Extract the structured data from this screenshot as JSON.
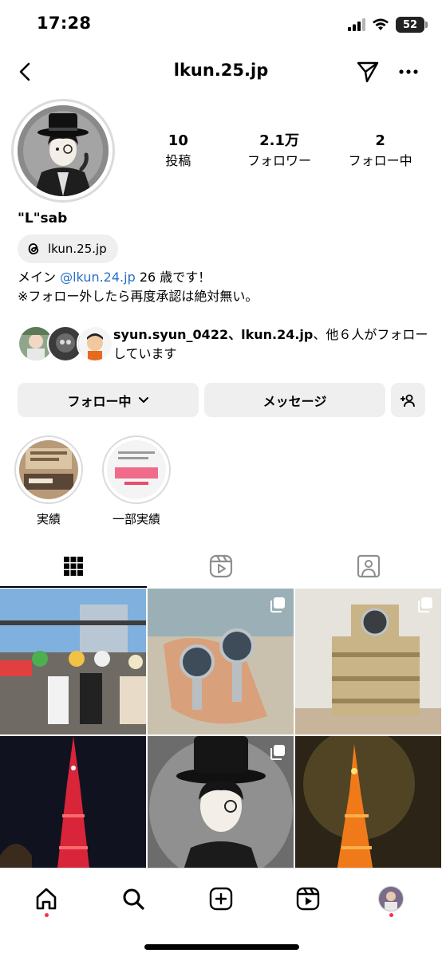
{
  "status_bar": {
    "time": "17:28",
    "battery": "52"
  },
  "header": {
    "username": "lkun.25.jp"
  },
  "profile": {
    "stats": [
      {
        "value": "10",
        "label": "投稿"
      },
      {
        "value": "2.1万",
        "label": "フォロワー"
      },
      {
        "value": "2",
        "label": "フォロー中"
      }
    ],
    "display_name": "\"L\"sab",
    "threads_handle": "lkun.25.jp",
    "bio": {
      "prefix": "メイン ",
      "mention": "@lkun.24.jp",
      "suffix": " 26 歳です！",
      "line2": "※フォロー外したら再度承認は絶対無い。"
    },
    "followed_by": {
      "names": "syun.syun_0422、lkun.24.jp",
      "rest": "、他６人がフォローしています"
    }
  },
  "actions": {
    "follow_label": "フォロー中",
    "message_label": "メッセージ"
  },
  "highlights": [
    {
      "label": "実績"
    },
    {
      "label": "一部実績"
    }
  ],
  "nav": {
    "items": [
      "home",
      "search",
      "create",
      "reels",
      "profile"
    ]
  },
  "colors": {
    "link": "#2970c4",
    "button_bg": "#efefef",
    "notification_dot": "#ff3040",
    "divider": "#dbdbdb"
  }
}
